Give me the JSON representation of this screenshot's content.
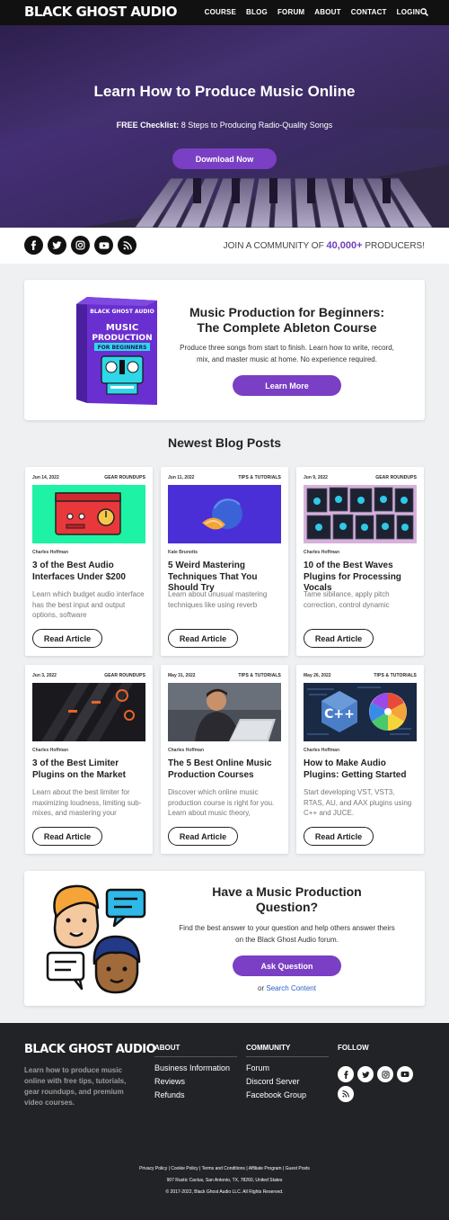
{
  "nav": {
    "logo": "BLACK GHOST AUDIO",
    "items": [
      "COURSE",
      "BLOG",
      "FORUM",
      "ABOUT",
      "CONTACT",
      "LOGIN"
    ],
    "search_icon": "search-icon"
  },
  "hero": {
    "title": "Learn How to Produce Music Online",
    "sub_bold": "FREE Checklist:",
    "sub_text": " 8 Steps to Producing Radio-Quality Songs",
    "button": "Download Now"
  },
  "social": {
    "icons": [
      "facebook-icon",
      "twitter-icon",
      "instagram-icon",
      "youtube-icon",
      "rss-icon"
    ],
    "community_pre": "JOIN A COMMUNITY OF ",
    "community_count": "40,000+",
    "community_post": " PRODUCERS!"
  },
  "course": {
    "box_brand": "BLACK GHOST AUDIO",
    "box_line1": "MUSIC",
    "box_line2": "PRODUCTION",
    "box_line3": "FOR BEGINNERS",
    "title_line1": "Music Production for Beginners:",
    "title_line2": "The Complete Ableton Course",
    "description": "Produce three songs from start to finish. Learn how to write, record, mix, and master music at home. No experience required.",
    "button": "Learn More"
  },
  "blog": {
    "heading": "Newest Blog Posts",
    "read_label": "Read Article",
    "posts": [
      {
        "date": "Jun 14, 2022",
        "category": "GEAR ROUNDUPS",
        "author": "Charles Hoffman",
        "title": "3 of the Best Audio Interfaces Under $200",
        "excerpt": "Learn which budget audio interface has the best input and output options, software"
      },
      {
        "date": "Jun 11, 2022",
        "category": "TIPS & TUTORIALS",
        "author": "Kate Brunotts",
        "title": "5 Weird Mastering Techniques That You Should Try",
        "excerpt": "Learn about unusual mastering techniques like using reverb"
      },
      {
        "date": "Jun 9, 2022",
        "category": "GEAR ROUNDUPS",
        "author": "Charles Hoffman",
        "title": "10 of the Best Waves Plugins for Processing Vocals",
        "excerpt": "Tame sibilance, apply pitch correction, control dynamic"
      },
      {
        "date": "Jun 3, 2022",
        "category": "GEAR ROUNDUPS",
        "author": "Charles Hoffman",
        "title": "3 of the Best Limiter Plugins on the Market",
        "excerpt": "Learn about the best limiter for maximizing loudness, limiting sub-mixes, and mastering your"
      },
      {
        "date": "May 31, 2022",
        "category": "TIPS & TUTORIALS",
        "author": "Charles Hoffman",
        "title": "The 5 Best Online Music Production Courses",
        "excerpt": "Discover which online music production course is right for you. Learn about music theory,"
      },
      {
        "date": "May 26, 2022",
        "category": "TIPS & TUTORIALS",
        "author": "Charles Hoffman",
        "title": "How to Make Audio Plugins: Getting Started",
        "excerpt": "Start developing VST, VST3, RTAS, AU, and AAX plugins using C++ and JUCE."
      }
    ]
  },
  "question": {
    "title_line1": "Have a Music Production",
    "title_line2": "Question?",
    "description": "Find the best answer to your question and help others answer theirs on the Black Ghost Audio forum.",
    "button": "Ask Question",
    "or_text": "or ",
    "search_link": "Search Content"
  },
  "footer": {
    "logo": "BLACK GHOST AUDIO",
    "tagline": "Learn how to produce music online with free tips, tutorials, gear roundups, and premium video courses.",
    "about_heading": "ABOUT",
    "about_links": [
      "Business Information",
      "Reviews",
      "Refunds"
    ],
    "community_heading": "COMMUNITY",
    "community_links": [
      "Forum",
      "Discord Server",
      "Facebook Group"
    ],
    "follow_heading": "FOLLOW",
    "legal_links": "Privacy Policy | Cookie Policy | Terms and Conditions | Affiliate Program | Guest Posts",
    "address": "907 Rustic Cactus, San Antonio, TX, 78260, United States",
    "copyright": "© 2017-2022, Black Ghost Audio LLC. All Rights Reserved."
  }
}
